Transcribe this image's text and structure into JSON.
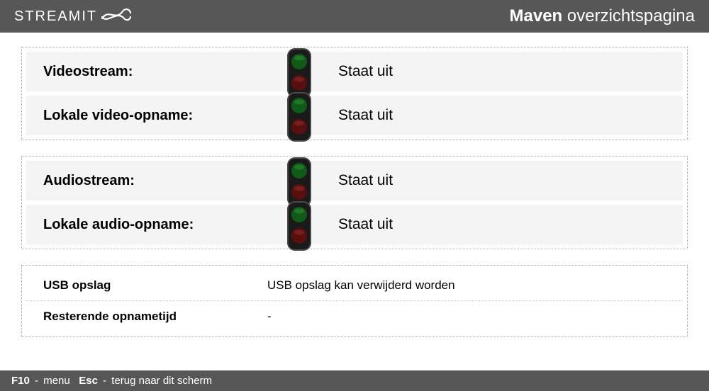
{
  "header": {
    "logo_text": "STREAMIT",
    "title_bold": "Maven",
    "title_light": "overzichtspagina"
  },
  "status_groups": [
    {
      "rows": [
        {
          "label": "Videostream:",
          "value": "Staat uit",
          "light": "red"
        },
        {
          "label": "Lokale video-opname:",
          "value": "Staat uit",
          "light": "red"
        }
      ]
    },
    {
      "rows": [
        {
          "label": "Audiostream:",
          "value": "Staat uit",
          "light": "red"
        },
        {
          "label": "Lokale audio-opname:",
          "value": "Staat uit",
          "light": "red"
        }
      ]
    }
  ],
  "info": {
    "rows": [
      {
        "label": "USB opslag",
        "value": "USB opslag kan verwijderd worden"
      },
      {
        "label": "Resterende opnametijd",
        "value": "-"
      }
    ]
  },
  "footer": {
    "key1": "F10",
    "key1_desc": "menu",
    "key2": "Esc",
    "key2_desc": "terug naar dit scherm"
  }
}
